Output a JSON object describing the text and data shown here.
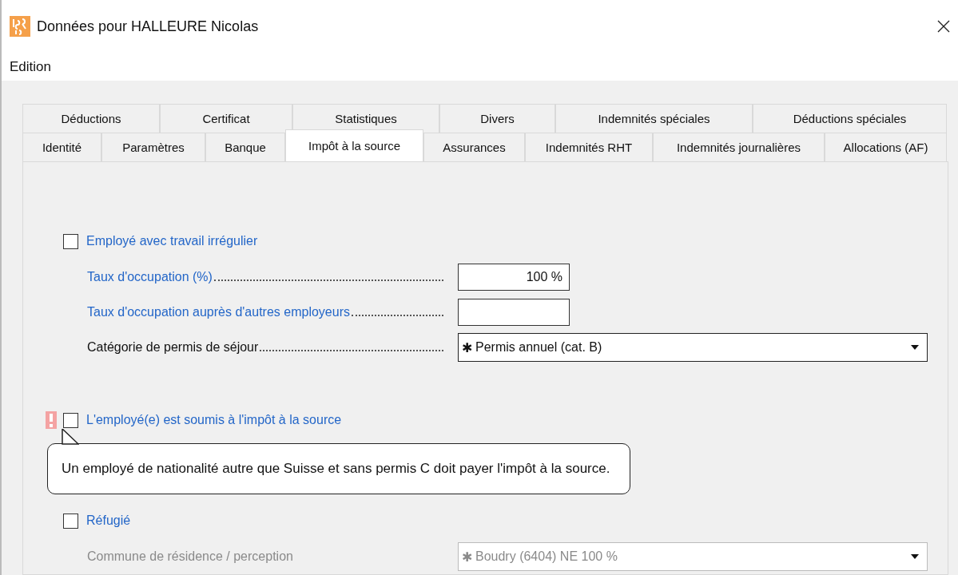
{
  "window": {
    "title": "Données pour HALLEURE Nicolas"
  },
  "menu": [
    "Edition"
  ],
  "tab_strip": {
    "back_row": {
      "tabs": [
        {
          "label": "Déductions",
          "selected": false
        },
        {
          "label": "Certificat",
          "selected": false
        },
        {
          "label": "Statistiques",
          "selected": false
        },
        {
          "label": "Divers",
          "selected": false
        },
        {
          "label": "Indemnités spéciales",
          "selected": false
        },
        {
          "label": "Déductions spéciales",
          "selected": false
        }
      ]
    },
    "front_row": {
      "tabs": [
        {
          "label": "Identité",
          "selected": false
        },
        {
          "label": "Paramètres",
          "selected": false
        },
        {
          "label": "Banque",
          "selected": false
        },
        {
          "label": "Impôt à la source",
          "selected": true
        },
        {
          "label": "Assurances",
          "selected": false
        },
        {
          "label": "Indemnités RHT",
          "selected": false
        },
        {
          "label": "Indemnités journalières",
          "selected": false
        },
        {
          "label": "Allocations (AF)",
          "selected": false
        }
      ]
    }
  },
  "form": {
    "items": [
      {
        "kind": "checkbox",
        "label": "Employé avec travail irrégulier",
        "checked": false
      },
      {
        "kind": "field",
        "label": "Taux d'occupation (%)",
        "value": "100 %",
        "required": false
      },
      {
        "kind": "field",
        "label": "Taux d'occupation auprès d'autres employeurs",
        "required": false
      },
      {
        "kind": "select",
        "label": "Catégorie de permis de séjour",
        "prefix": "✱",
        "value": "Permis annuel (cat. B)",
        "required": true
      },
      {
        "kind": "gap"
      },
      {
        "kind": "checkbox",
        "label": "L'employé(e) est soumis à l'impôt à la source",
        "checked": false,
        "warning": true
      },
      {
        "kind": "gap"
      },
      {
        "kind": "checkbox",
        "label": "Réfugié",
        "checked": false
      },
      {
        "kind": "select",
        "label": "Commune de résidence / perception",
        "prefix": "✱",
        "value": "Boudry (6404) NE 100 %",
        "required": false,
        "dimmed": true
      }
    ]
  },
  "tooltip": {
    "text": "Un employé de nationalité autre que Suisse et sans permis C doit payer l'impôt à la source."
  }
}
